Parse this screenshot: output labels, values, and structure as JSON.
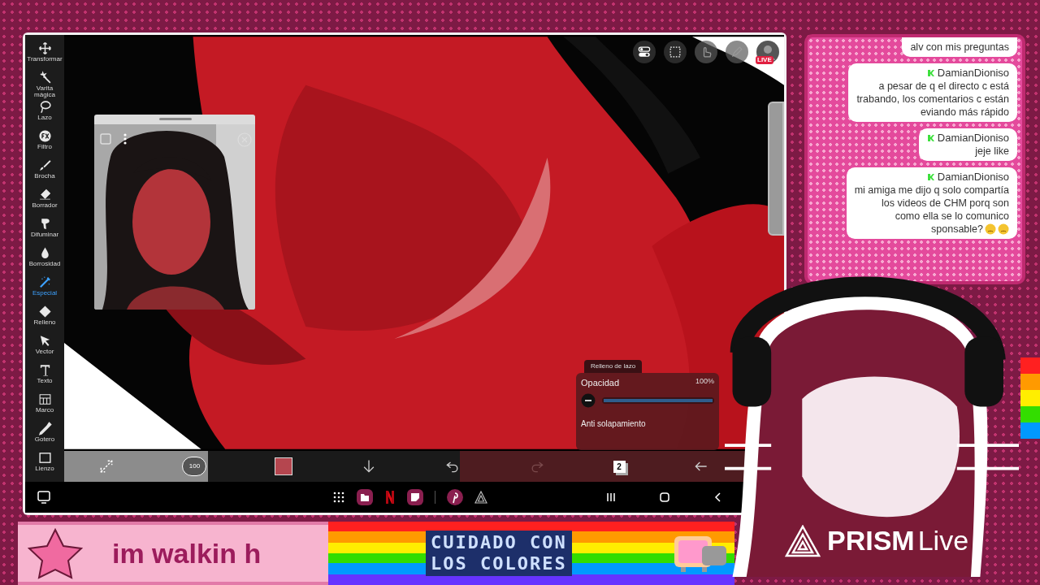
{
  "app": {
    "tools": [
      {
        "label": "Transformar",
        "selected": false
      },
      {
        "label": "Varita mágica",
        "selected": false
      },
      {
        "label": "Lazo",
        "selected": false
      },
      {
        "label": "Filtro",
        "selected": false
      },
      {
        "label": "Brocha",
        "selected": false
      },
      {
        "label": "Borrador",
        "selected": false
      },
      {
        "label": "Difuminar",
        "selected": false
      },
      {
        "label": "Borrosidad",
        "selected": false
      },
      {
        "label": "Especial",
        "selected": true
      },
      {
        "label": "Relleno",
        "selected": false
      },
      {
        "label": "Vector",
        "selected": false
      },
      {
        "label": "Texto",
        "selected": false
      },
      {
        "label": "Marco",
        "selected": false
      },
      {
        "label": "Gotero",
        "selected": false
      },
      {
        "label": "Lienzo",
        "selected": false
      }
    ],
    "top_icons": [
      {
        "kind": "toggle",
        "disabled": false
      },
      {
        "kind": "selection",
        "disabled": false
      },
      {
        "kind": "hand",
        "disabled": true
      },
      {
        "kind": "pen",
        "disabled": true
      }
    ],
    "live_badge": "LIVE",
    "brush_panel": {
      "tab": "Relleno de lazo",
      "opacity": {
        "label": "Opacidad",
        "reading": "100%",
        "level": 1
      },
      "option": "Anti solapamiento"
    },
    "bottom_toolbar": {
      "brush_size": "100",
      "color": "#b5464f",
      "layer_count": "2",
      "redo_disabled": true
    }
  },
  "chat": [
    {
      "lines": [
        "alv con mis preguntas"
      ]
    },
    {
      "user": "DamianDioniso",
      "lines": [
        "a pesar de q el directo c está",
        "trabando, los comentarios c están",
        "eviando más rápido"
      ]
    },
    {
      "user": "DamianDioniso",
      "lines": [
        "jeje like"
      ]
    },
    {
      "user": "DamianDioniso",
      "lines": [
        "mi amiga me dijo q solo compartía",
        "los videos de CHM porq son",
        "como ella se lo comunico",
        "sponsable?"
      ]
    }
  ],
  "banner": {
    "scroll_text": "im walkin h",
    "warning_lines": [
      "CUIDADO CON",
      "LOS COLORES"
    ]
  },
  "logo": {
    "name": "PRISM",
    "suffix": "Live"
  }
}
